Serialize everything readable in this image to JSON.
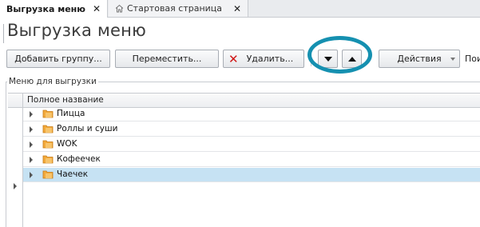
{
  "tabs": [
    {
      "label": "Выгрузка меню",
      "active": true
    },
    {
      "label": "Стартовая страница",
      "active": false,
      "icon": "home-icon"
    }
  ],
  "page": {
    "title": "Выгрузка меню"
  },
  "toolbar": {
    "add_group": "Добавить группу...",
    "move": "Переместить...",
    "delete": "Удалить...",
    "actions": "Действия",
    "search_label": "Пои"
  },
  "group": {
    "legend": "Меню для выгрузки"
  },
  "grid": {
    "column_header": "Полное название",
    "rows": [
      {
        "label": "Пицца",
        "selected": false
      },
      {
        "label": "Роллы и суши",
        "selected": false
      },
      {
        "label": "WOK",
        "selected": false
      },
      {
        "label": "Кофеечек",
        "selected": false
      },
      {
        "label": "Чаечек",
        "selected": true
      }
    ]
  },
  "colors": {
    "accent_ring": "#1590b0",
    "selection": "#c6e2f3",
    "delete_icon": "#d01818"
  }
}
